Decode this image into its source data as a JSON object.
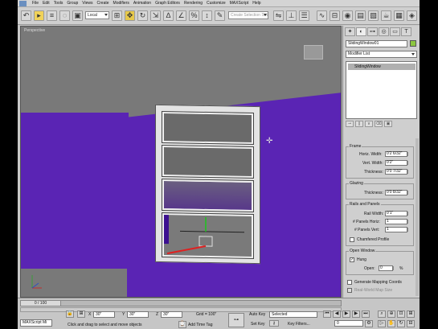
{
  "menu": [
    "File",
    "Edit",
    "Tools",
    "Group",
    "Views",
    "Create",
    "Modifiers",
    "Animation",
    "Graph Editors",
    "Rendering",
    "Customize",
    "MAXScript",
    "Help"
  ],
  "toolbar": {
    "reference_coord": "Local",
    "selection_set_placeholder": "Create Selection Set"
  },
  "viewport": {
    "label": "Perspective"
  },
  "command_panel": {
    "object_name": "SlidingWindow01",
    "modifier_list": "Modifier List",
    "stack_item": "SlidingWindow",
    "swatch_color": "#8cc63f",
    "frame": {
      "title": "Frame",
      "horiz_width_label": "Horiz. Width:",
      "horiz_width": "0'2 6/32\"",
      "vert_width_label": "Vert. Width:",
      "vert_width": "0'2\"",
      "thickness_label": "Thickness:",
      "thickness": "0'0 7/32\""
    },
    "glazing": {
      "title": "Glazing",
      "thickness_label": "Thickness:",
      "thickness": "0'0 8/32\""
    },
    "rails": {
      "title": "Rails and Panels",
      "rail_width_label": "Rail Width:",
      "rail_width": "0'1\"",
      "panels_horiz_label": "# Panels Horiz:",
      "panels_horiz": "1",
      "panels_vert_label": "# Panels Vert:",
      "panels_vert": "1",
      "chamfered_label": "Chamfered Profile",
      "chamfered_checked": false
    },
    "open_window": {
      "title": "Open Window",
      "hung_label": "Hung",
      "hung_checked": true,
      "open_label": "Open:",
      "open_value": "0",
      "open_unit": "%"
    },
    "generate_mapping_label": "Generate Mapping Coords",
    "real_world_label": "Real-World Map Size"
  },
  "bottom": {
    "frame_counter": "0 / 100",
    "listener": "MAXScript Mi",
    "x": "30\"",
    "y": "30\"",
    "z": "30\"",
    "grid": "Grid = 100\"",
    "status_text": "Click and drag to select and move objects",
    "add_time_tag": "Add Time Tag",
    "auto_key": "Auto Key",
    "set_key": "Set Key",
    "key_mode": "Selected",
    "key_filters": "Key Filters...",
    "current_frame": "0"
  }
}
